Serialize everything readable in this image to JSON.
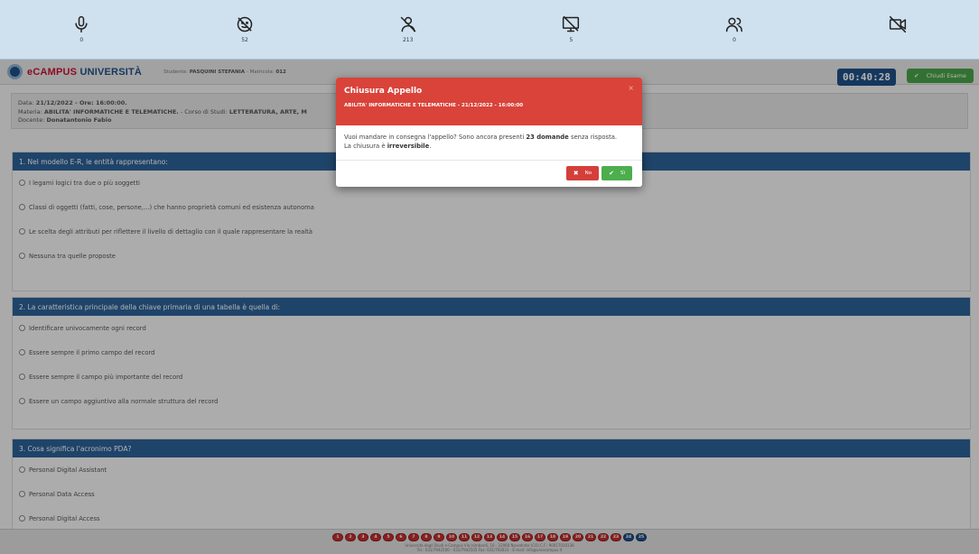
{
  "proctor": {
    "items": [
      {
        "name": "microphone",
        "count": "0"
      },
      {
        "name": "face-blocked",
        "count": "52"
      },
      {
        "name": "person-off",
        "count": "213"
      },
      {
        "name": "screen-off",
        "count": "5"
      },
      {
        "name": "multiple-people",
        "count": "0"
      },
      {
        "name": "camera-off",
        "count": ""
      }
    ]
  },
  "header": {
    "logo_brand": "eCAMPUS",
    "logo_uni": " UNIVERSITÀ",
    "student_label": "Studente:",
    "student_name": "PASQUINI STEFANIA",
    "matricola_label": "- Matricola:",
    "matricola": "012",
    "timer": "00:40:28",
    "close_exam": "Chiudi Esame"
  },
  "info": {
    "data_label": "Data:",
    "data": "21/12/2022 - Ore: 16:00:00.",
    "materia_label": "Materia:",
    "materia": "ABILITA' INFORMATICHE E TELEMATICHE.",
    "corso_label": "- Corso di Studi:",
    "corso": "LETTERATURA, ARTE, M",
    "docente_label": "Docente:",
    "docente": "Donatantonio Fabio"
  },
  "questions": [
    {
      "title": "1. Nel modello E-R, le entità rappresentano:",
      "options": [
        "I legami logici tra due o più soggetti",
        "Classi di oggetti (fatti, cose, persone,...) che hanno proprietà comuni ed esistenza autonoma",
        "Le scelta degli attributi per riflettere il livello di dettaglio con il quale rappresentare la realtà",
        "Nessuna tra quelle proposte"
      ]
    },
    {
      "title": "2. La caratteristica principale della chiave primaria di una tabella è quella di:",
      "options": [
        "Identificare univocamente ogni record",
        "Essere sempre il primo campo del record",
        "Essere sempre il campo più importante del record",
        "Essere un campo aggiuntivo alla normale struttura del record"
      ]
    },
    {
      "title": "3. Cosa significa l'acronimo PDA?",
      "options": [
        "Personal Digital Assistant",
        "Personal Data Access",
        "Personal Digital Access"
      ]
    }
  ],
  "pager": {
    "pages": [
      "1",
      "2",
      "3",
      "4",
      "5",
      "6",
      "7",
      "8",
      "9",
      "10",
      "11",
      "12",
      "13",
      "14",
      "15",
      "16",
      "17",
      "18",
      "19",
      "20",
      "21",
      "22",
      "23",
      "24",
      "25"
    ],
    "answered": [
      "24",
      "25"
    ]
  },
  "footer": {
    "line1": "Università degli Studi e-Campus Via Isimbardi, 10 - 22060 Novedrate (CO) C.F.: 90017020138",
    "line2": "Tel.: 031/7942500 - 031/7942505 Fax: 031/792631 - E-mail: info@uniecampus.it"
  },
  "modal": {
    "title": "Chiusura Appello",
    "close": "×",
    "subtitle": "ABILITA' INFORMATICHE E TELEMATICHE - 21/12/2022 - 16:00:00",
    "text_1": "Vuoi mandare in consegna l'appello? Sono ancora presenti",
    "count_text": "23 domande",
    "text_2": "senza risposta.",
    "text_3": "La chiusura è",
    "irreversible": "irreversibile",
    "text_4": ".",
    "no_label": "No",
    "yes_label": "Sì"
  },
  "colors": {
    "accent": "#2d6298",
    "danger": "#d9433a",
    "success": "#4cae4c",
    "proctor_bar": "#cfe1ef"
  }
}
